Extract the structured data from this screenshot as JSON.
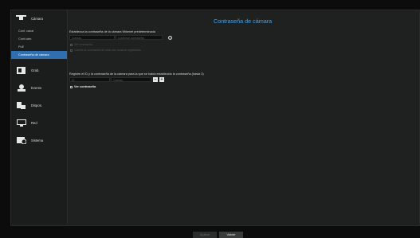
{
  "sidebar": {
    "camera": {
      "label": "Cámara",
      "items": [
        {
          "label": "Conf. canal",
          "active": false
        },
        {
          "label": "Conf.cám.",
          "active": false
        },
        {
          "label": "PoE",
          "active": false
        },
        {
          "label": "Contraseña de cámara",
          "active": true
        }
      ]
    },
    "groups": [
      {
        "label": "Grab.",
        "icon": "record-icon"
      },
      {
        "label": "Evento",
        "icon": "event-icon"
      },
      {
        "label": "Dispos.",
        "icon": "device-icon"
      },
      {
        "label": "Red",
        "icon": "network-icon"
      },
      {
        "label": "Sistema",
        "icon": "system-icon"
      }
    ]
  },
  "main": {
    "title": "Contraseña de cámara",
    "default_section_label": "Establezca la contraseña de la cámara Wisenet predeterminada",
    "password_placeholder": "Contras.",
    "confirm_placeholder": "Confirmar contraseña",
    "show_password_option": "Ver contraseña",
    "update_option": "Cambie la contraseña de todas las cámaras registradas",
    "registered_section_label": "Registre el ID y la contraseña de la cámara para la que se había establecido la contraseña (hasta 3)",
    "id_placeholder": "ID",
    "id_password_placeholder": "Contras.",
    "minus_label": "−",
    "plus_label": "+",
    "show_password_checkbox": "Ver contraseña",
    "info_glyph": "i"
  },
  "footer": {
    "apply_label": "Aplicar",
    "back_label": "Volver"
  },
  "colors": {
    "accent": "#4aa3e8",
    "active_item": "#2f6fb0"
  }
}
